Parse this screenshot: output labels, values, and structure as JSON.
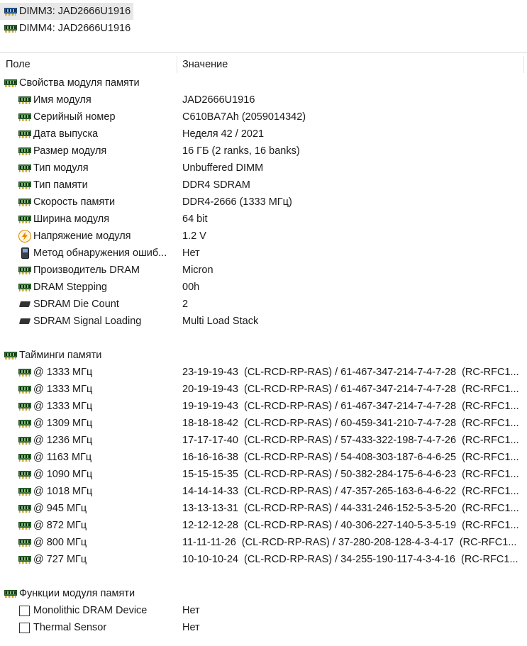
{
  "dimm_list": [
    {
      "label": "DIMM3: JAD2666U1916",
      "selected": true
    },
    {
      "label": "DIMM4: JAD2666U1916",
      "selected": false
    }
  ],
  "columns": {
    "field": "Поле",
    "value": "Значение"
  },
  "sections": {
    "module_props": {
      "title": "Свойства модуля памяти",
      "rows": [
        {
          "icon": "ram-icon",
          "field": "Имя модуля",
          "value": "JAD2666U1916"
        },
        {
          "icon": "ram-icon",
          "field": "Серийный номер",
          "value": "C610BA7Ah (2059014342)"
        },
        {
          "icon": "ram-icon",
          "field": "Дата выпуска",
          "value": "Неделя 42 / 2021"
        },
        {
          "icon": "ram-icon",
          "field": "Размер модуля",
          "value": "16 ГБ (2 ranks, 16 banks)"
        },
        {
          "icon": "ram-icon",
          "field": "Тип модуля",
          "value": "Unbuffered DIMM"
        },
        {
          "icon": "ram-icon",
          "field": "Тип памяти",
          "value": "DDR4 SDRAM"
        },
        {
          "icon": "ram-icon",
          "field": "Скорость памяти",
          "value": "DDR4-2666 (1333 МГц)"
        },
        {
          "icon": "ram-icon",
          "field": "Ширина модуля",
          "value": "64 bit"
        },
        {
          "icon": "lightning-icon",
          "field": "Напряжение модуля",
          "value": "1.2 V"
        },
        {
          "icon": "device-icon",
          "field": "Метод обнаружения ошиб...",
          "value": "Нет"
        },
        {
          "icon": "ram-icon",
          "field": "Производитель DRAM",
          "value": "Micron"
        },
        {
          "icon": "ram-icon",
          "field": "DRAM Stepping",
          "value": "00h"
        },
        {
          "icon": "chip-icon",
          "field": "SDRAM Die Count",
          "value": "2"
        },
        {
          "icon": "chip-icon",
          "field": "SDRAM Signal Loading",
          "value": "Multi Load Stack"
        }
      ]
    },
    "timings": {
      "title": "Тайминги памяти",
      "rows": [
        {
          "field": "@ 1333 МГц",
          "value": "23-19-19-43  (CL-RCD-RP-RAS) / 61-467-347-214-7-4-7-28  (RC-RFC1..."
        },
        {
          "field": "@ 1333 МГц",
          "value": "20-19-19-43  (CL-RCD-RP-RAS) / 61-467-347-214-7-4-7-28  (RC-RFC1..."
        },
        {
          "field": "@ 1333 МГц",
          "value": "19-19-19-43  (CL-RCD-RP-RAS) / 61-467-347-214-7-4-7-28  (RC-RFC1..."
        },
        {
          "field": "@ 1309 МГц",
          "value": "18-18-18-42  (CL-RCD-RP-RAS) / 60-459-341-210-7-4-7-28  (RC-RFC1..."
        },
        {
          "field": "@ 1236 МГц",
          "value": "17-17-17-40  (CL-RCD-RP-RAS) / 57-433-322-198-7-4-7-26  (RC-RFC1..."
        },
        {
          "field": "@ 1163 МГц",
          "value": "16-16-16-38  (CL-RCD-RP-RAS) / 54-408-303-187-6-4-6-25  (RC-RFC1..."
        },
        {
          "field": "@ 1090 МГц",
          "value": "15-15-15-35  (CL-RCD-RP-RAS) / 50-382-284-175-6-4-6-23  (RC-RFC1..."
        },
        {
          "field": "@ 1018 МГц",
          "value": "14-14-14-33  (CL-RCD-RP-RAS) / 47-357-265-163-6-4-6-22  (RC-RFC1..."
        },
        {
          "field": "@ 945 МГц",
          "value": "13-13-13-31  (CL-RCD-RP-RAS) / 44-331-246-152-5-3-5-20  (RC-RFC1..."
        },
        {
          "field": "@ 872 МГц",
          "value": "12-12-12-28  (CL-RCD-RP-RAS) / 40-306-227-140-5-3-5-19  (RC-RFC1..."
        },
        {
          "field": "@ 800 МГц",
          "value": "11-11-11-26  (CL-RCD-RP-RAS) / 37-280-208-128-4-3-4-17  (RC-RFC1..."
        },
        {
          "field": "@ 727 МГц",
          "value": "10-10-10-24  (CL-RCD-RP-RAS) / 34-255-190-117-4-3-4-16  (RC-RFC1..."
        }
      ]
    },
    "functions": {
      "title": "Функции модуля памяти",
      "rows": [
        {
          "field": "Monolithic DRAM Device",
          "value": "Нет",
          "checked": false
        },
        {
          "field": "Thermal Sensor",
          "value": "Нет",
          "checked": false
        }
      ]
    }
  }
}
